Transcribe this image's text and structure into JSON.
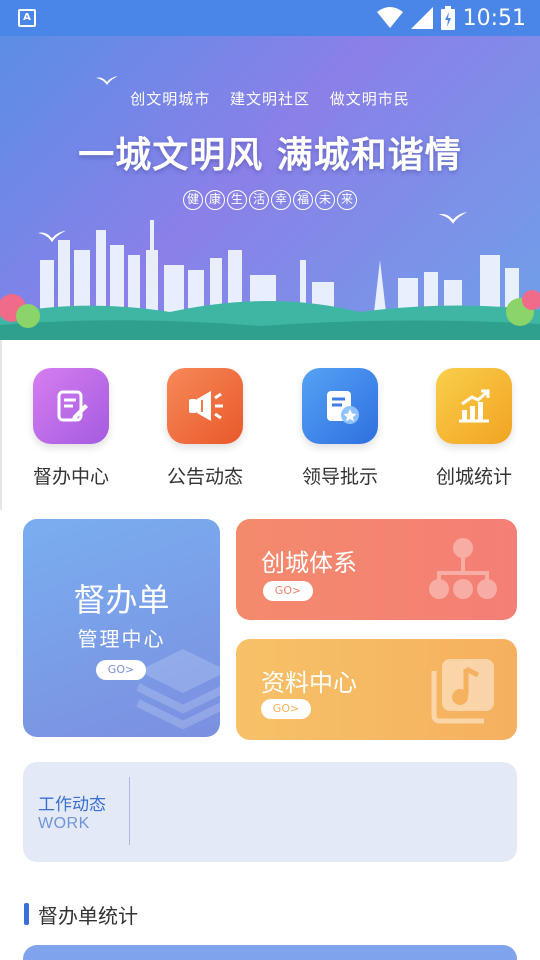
{
  "status_bar": {
    "time": "10:51",
    "app_icon": "A"
  },
  "banner": {
    "slogans": "创文明城市 建文明社区 做文明市民",
    "title": "一城文明风 满城和谐情",
    "subtitle_chars": [
      "健",
      "康",
      "生",
      "活",
      "幸",
      "福",
      "未",
      "来"
    ]
  },
  "quick_menu": [
    {
      "label": "督办中心",
      "icon": "edit-document-icon",
      "color": "#b86ae6"
    },
    {
      "label": "公告动态",
      "icon": "megaphone-icon",
      "color": "#f06a3c"
    },
    {
      "label": "领导批示",
      "icon": "document-star-icon",
      "color": "#3f7ee8"
    },
    {
      "label": "创城统计",
      "icon": "bar-chart-icon",
      "color": "#f5b02e"
    }
  ],
  "cards": {
    "supervise": {
      "title": "督办单",
      "subtitle": "管理中心",
      "go": "GO>"
    },
    "system": {
      "title": "创城体系",
      "go": "GO>"
    },
    "resources": {
      "title": "资料中心",
      "go": "GO>"
    }
  },
  "work_news": {
    "title": "工作动态",
    "subtitle": "WORK"
  },
  "stats_section": {
    "title": "督办单统计"
  }
}
